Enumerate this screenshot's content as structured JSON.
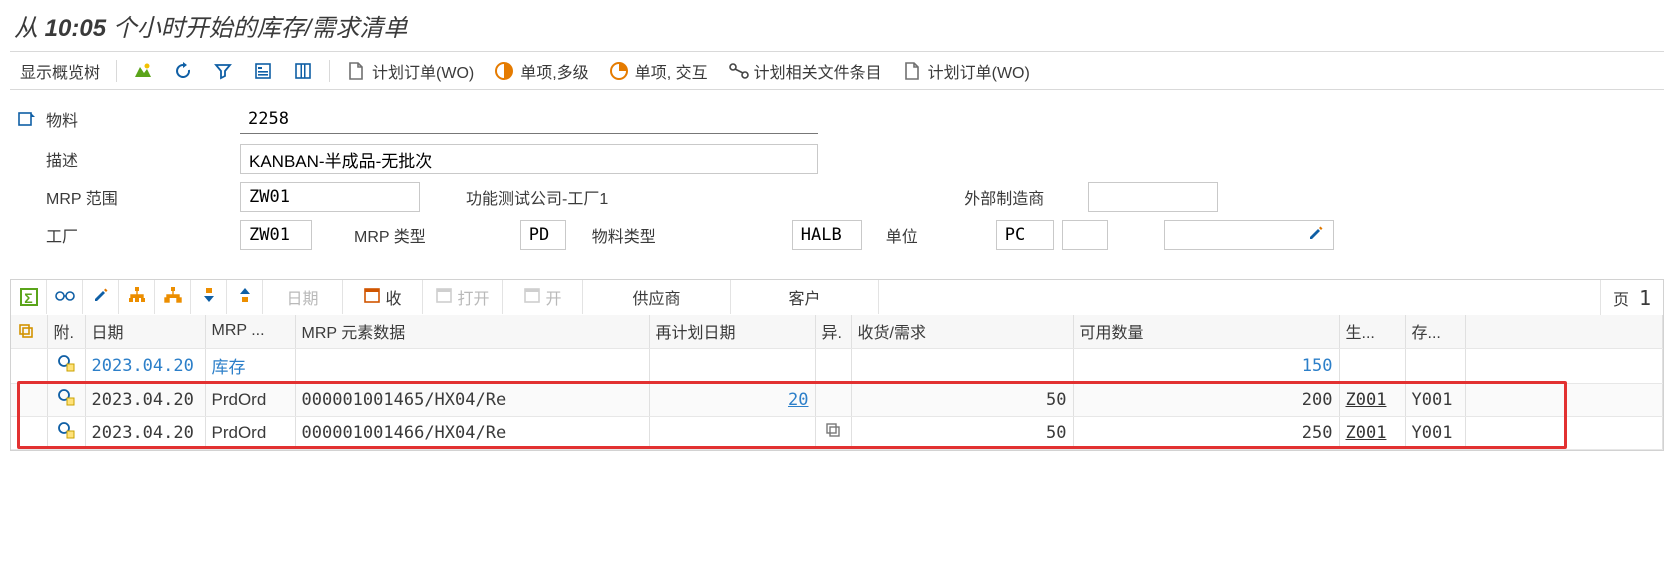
{
  "title": {
    "prefix": "从 ",
    "time": "10:05",
    "suffix": " 个小时开始的库存/需求清单"
  },
  "toolbar": {
    "overview_tree": "显示概览树",
    "plan_order_wo_1": "计划订单(WO)",
    "single_multi": "单项,多级",
    "single_interactive": "单项, 交互",
    "pegging": "计划相关文件条目",
    "plan_order_wo_2": "计划订单(WO)"
  },
  "form": {
    "material_lbl": "物料",
    "material_val": "2258",
    "desc_lbl": "描述",
    "desc_val": "KANBAN-半成品-无批次",
    "mrp_area_lbl": "MRP 范围",
    "mrp_area_val": "ZW01",
    "mrp_area_text": "功能测试公司-工厂1",
    "ext_mfr_lbl": "外部制造商",
    "ext_mfr_val": "",
    "plant_lbl": "工厂",
    "plant_val": "ZW01",
    "mrp_type_lbl": "MRP 类型",
    "mrp_type_val": "PD",
    "mat_type_lbl": "物料类型",
    "mat_type_val": "HALB",
    "uom_lbl": "单位",
    "uom_val": "PC"
  },
  "grid_toolbar": {
    "date": "日期",
    "gr": "收",
    "open": "打开",
    "on": "开",
    "vendor": "供应商",
    "customer": "客户",
    "page_lbl": "页",
    "page_num": "1"
  },
  "columns": {
    "att": "附.",
    "date": "日期",
    "mrp_el": "MRP ...",
    "el_data": "MRP 元素数据",
    "replan": "再计划日期",
    "exc": "异.",
    "qty": "收货/需求",
    "avail": "可用数量",
    "ship": "生...",
    "stor": "存..."
  },
  "rows": [
    {
      "date": "2023.04.20",
      "mrp_el": "库存",
      "el_data": "",
      "replan": "",
      "exc": "",
      "qty": "",
      "avail": "150",
      "ship": "",
      "stor": "",
      "is_stock": true
    },
    {
      "date": "2023.04.20",
      "mrp_el": "PrdOrd",
      "el_data": "000001001465/HX04/Re",
      "replan": "20",
      "exc": "",
      "qty": "50",
      "avail": "200",
      "ship": "Z001",
      "stor": "Y001",
      "is_stock": false,
      "replan_link": true
    },
    {
      "date": "2023.04.20",
      "mrp_el": "PrdOrd",
      "el_data": "000001001466/HX04/Re",
      "replan": "",
      "exc": "⧉",
      "qty": "50",
      "avail": "250",
      "ship": "Z001",
      "stor": "Y001",
      "is_stock": false
    }
  ]
}
